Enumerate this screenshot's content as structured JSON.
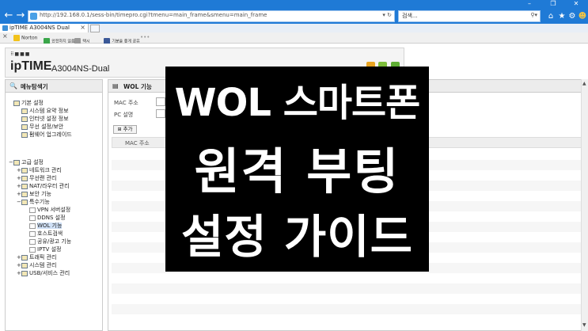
{
  "browser": {
    "url": "http://192.168.0.1/sess-bin/timepro.cgi?tmenu=main_frame&smenu=main_frame",
    "url_tools": "▾ ↻",
    "search_placeholder": "검색...",
    "search_icon": "⚲▾",
    "tab_title": "ipTIME A3004NS Dual",
    "win_controls": [
      "–",
      "❐",
      "✕"
    ],
    "nav_icons": [
      "back-icon",
      "forward-icon"
    ],
    "right_icons": [
      "home-icon",
      "star-icon",
      "gear-icon",
      "smiley-icon"
    ],
    "favorites": [
      {
        "label": "Norton",
        "icon": "norton-icon"
      },
      {
        "label": "안전하지 않음\n보안",
        "icon": "safe-icon"
      },
      {
        "label": "택시\n블루",
        "icon": "settings-icon"
      },
      {
        "label": "기분을 좋게 공유\nFACEBOOK",
        "icon": "facebook-icon"
      },
      {
        "label": "•••",
        "icon": "more-icon"
      }
    ],
    "accent": "#1f7ad6"
  },
  "router": {
    "logo": "ipTIME",
    "model": "A3004NS-Dual",
    "dots": "⠿■■■"
  },
  "menu": {
    "title": "메뉴탐색기",
    "items": [
      {
        "label": "기본 설정",
        "level": 0,
        "expand": ""
      },
      {
        "label": "시스템 요약 정보",
        "level": 1,
        "expand": ""
      },
      {
        "label": "인터넷 설정 정보",
        "level": 1,
        "expand": ""
      },
      {
        "label": "무선 설정/보안",
        "level": 1,
        "expand": ""
      },
      {
        "label": "펌웨어 업그레이드",
        "level": 1,
        "expand": ""
      },
      {
        "label": "고급 설정",
        "level": 0,
        "expand": "−"
      },
      {
        "label": "네트워크 관리",
        "level": 1,
        "expand": "+"
      },
      {
        "label": "무선랜 관리",
        "level": 1,
        "expand": "+"
      },
      {
        "label": "NAT/라우터 관리",
        "level": 1,
        "expand": "+"
      },
      {
        "label": "보안 기능",
        "level": 1,
        "expand": "+"
      },
      {
        "label": "특수기능",
        "level": 1,
        "expand": "−"
      },
      {
        "label": "VPN 서버설정",
        "level": 2,
        "expand": ""
      },
      {
        "label": "DDNS 설정",
        "level": 2,
        "expand": ""
      },
      {
        "label": "WOL 기능",
        "level": 2,
        "expand": "",
        "selected": true
      },
      {
        "label": "호스트검색",
        "level": 2,
        "expand": ""
      },
      {
        "label": "공유/광고 기능",
        "level": 2,
        "expand": ""
      },
      {
        "label": "IPTV 설정",
        "level": 2,
        "expand": ""
      },
      {
        "label": "트래픽 관리",
        "level": 1,
        "expand": "+"
      },
      {
        "label": "시스템 관리",
        "level": 1,
        "expand": "+"
      },
      {
        "label": "USB/서비스 관리",
        "level": 1,
        "expand": "+"
      }
    ]
  },
  "content": {
    "title": "WOL 기능",
    "mac_label": "MAC 주소",
    "pc_label": "PC 설명",
    "add_button": "추가",
    "table_header_mac": "MAC 주소"
  },
  "overlay": {
    "line1": "WOL 스마트폰",
    "line2": "원격 부팅",
    "line3": "설정 가이드"
  }
}
